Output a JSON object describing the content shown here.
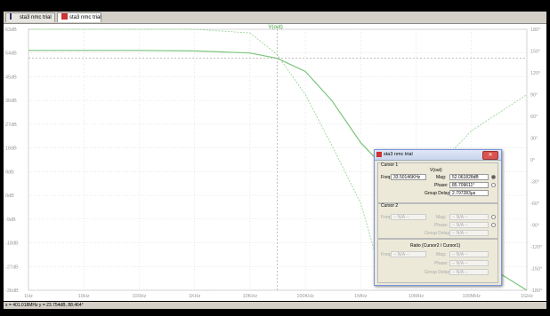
{
  "tabs": [
    {
      "label": "sta3 nmc trial"
    },
    {
      "label": "sta3 nmc trial"
    }
  ],
  "trace_label": "V(out)",
  "y_left_labels": [
    "63dB",
    "54dB",
    "45dB",
    "36dB",
    "27dB",
    "18dB",
    "9dB",
    "0dB",
    "-9dB",
    "-18dB",
    "-27dB",
    "-36dB"
  ],
  "y_right_labels": [
    "180°",
    "150°",
    "120°",
    "90°",
    "60°",
    "30°",
    "0°",
    "-30°",
    "-60°",
    "-90°",
    "-120°",
    "-150°",
    "-180°"
  ],
  "x_labels": [
    "1Hz",
    "10Hz",
    "100Hz",
    "1KHz",
    "10KHz",
    "100KHz",
    "1MHz",
    "10MHz",
    "100MHz",
    "1GHz"
  ],
  "status_text": "x = 401.018MHz   y = 23.754dB, 88.464°",
  "colors": {
    "magnitude": "#7cc47c",
    "phase": "#9ad49a",
    "grid": "#c8c8c8",
    "cursor": "#999"
  },
  "chart_data": {
    "type": "line",
    "x_scale": "log",
    "xlim_hz": [
      1,
      1000000000
    ],
    "ylim_db": [
      -36,
      63
    ],
    "ylim_phase_deg": [
      -180,
      180
    ],
    "magnitude_db": {
      "x_hz": [
        1,
        100,
        1000,
        10000,
        31000,
        100000,
        300000,
        1000000,
        10000000,
        100000000,
        1000000000
      ],
      "y": [
        55,
        55,
        54.8,
        54,
        52,
        47,
        36,
        20,
        -2,
        -23,
        -36
      ]
    },
    "phase_deg": {
      "x_hz": [
        1,
        1000,
        10000,
        31000,
        100000,
        300000,
        1000000,
        2000000,
        3000000,
        5000000,
        10000000,
        100000000,
        1000000000
      ],
      "y": [
        180,
        180,
        175,
        145,
        90,
        20,
        -60,
        -140,
        -150,
        -110,
        -40,
        40,
        90
      ]
    },
    "cursor_x_hz": 31000,
    "cursor_y_db": 52
  },
  "dialog": {
    "title": "sta3 nmc trial",
    "close": "✕",
    "cursor1_label": "Cursor 1",
    "cursor1_trace": "V(out)",
    "freq_label": "Freq:",
    "freq_value": "33.50146KHz",
    "mag_label": "Mag:",
    "mag_value": "52.061828dB",
    "phase_label": "Phase:",
    "phase_value": "85.709611°",
    "gd_label": "Group Delay:",
    "gd_value": "2.797283µs",
    "cursor2_label": "Cursor 2",
    "c2_freq_label": "Freq:",
    "c2_freq_value": "-- N/A --",
    "c2_mag_label": "Mag:",
    "c2_mag_value": "-- N/A --",
    "c2_phase_label": "Phase:",
    "c2_phase_value": "-- N/A --",
    "c2_gd_label": "Group Delay:",
    "c2_gd_value": "-- N/A --",
    "ratio_label": "Ratio (Cursor2 / Cursor1)",
    "r_freq_label": "Freq:",
    "r_freq_value": "-- N/A --",
    "r_mag_label": "Mag:",
    "r_mag_value": "-- N/A --",
    "r_phase_label": "Phase:",
    "r_phase_value": "-- N/A --",
    "r_gd_label": "Group Delay:",
    "r_gd_value": "-- N/A --"
  }
}
